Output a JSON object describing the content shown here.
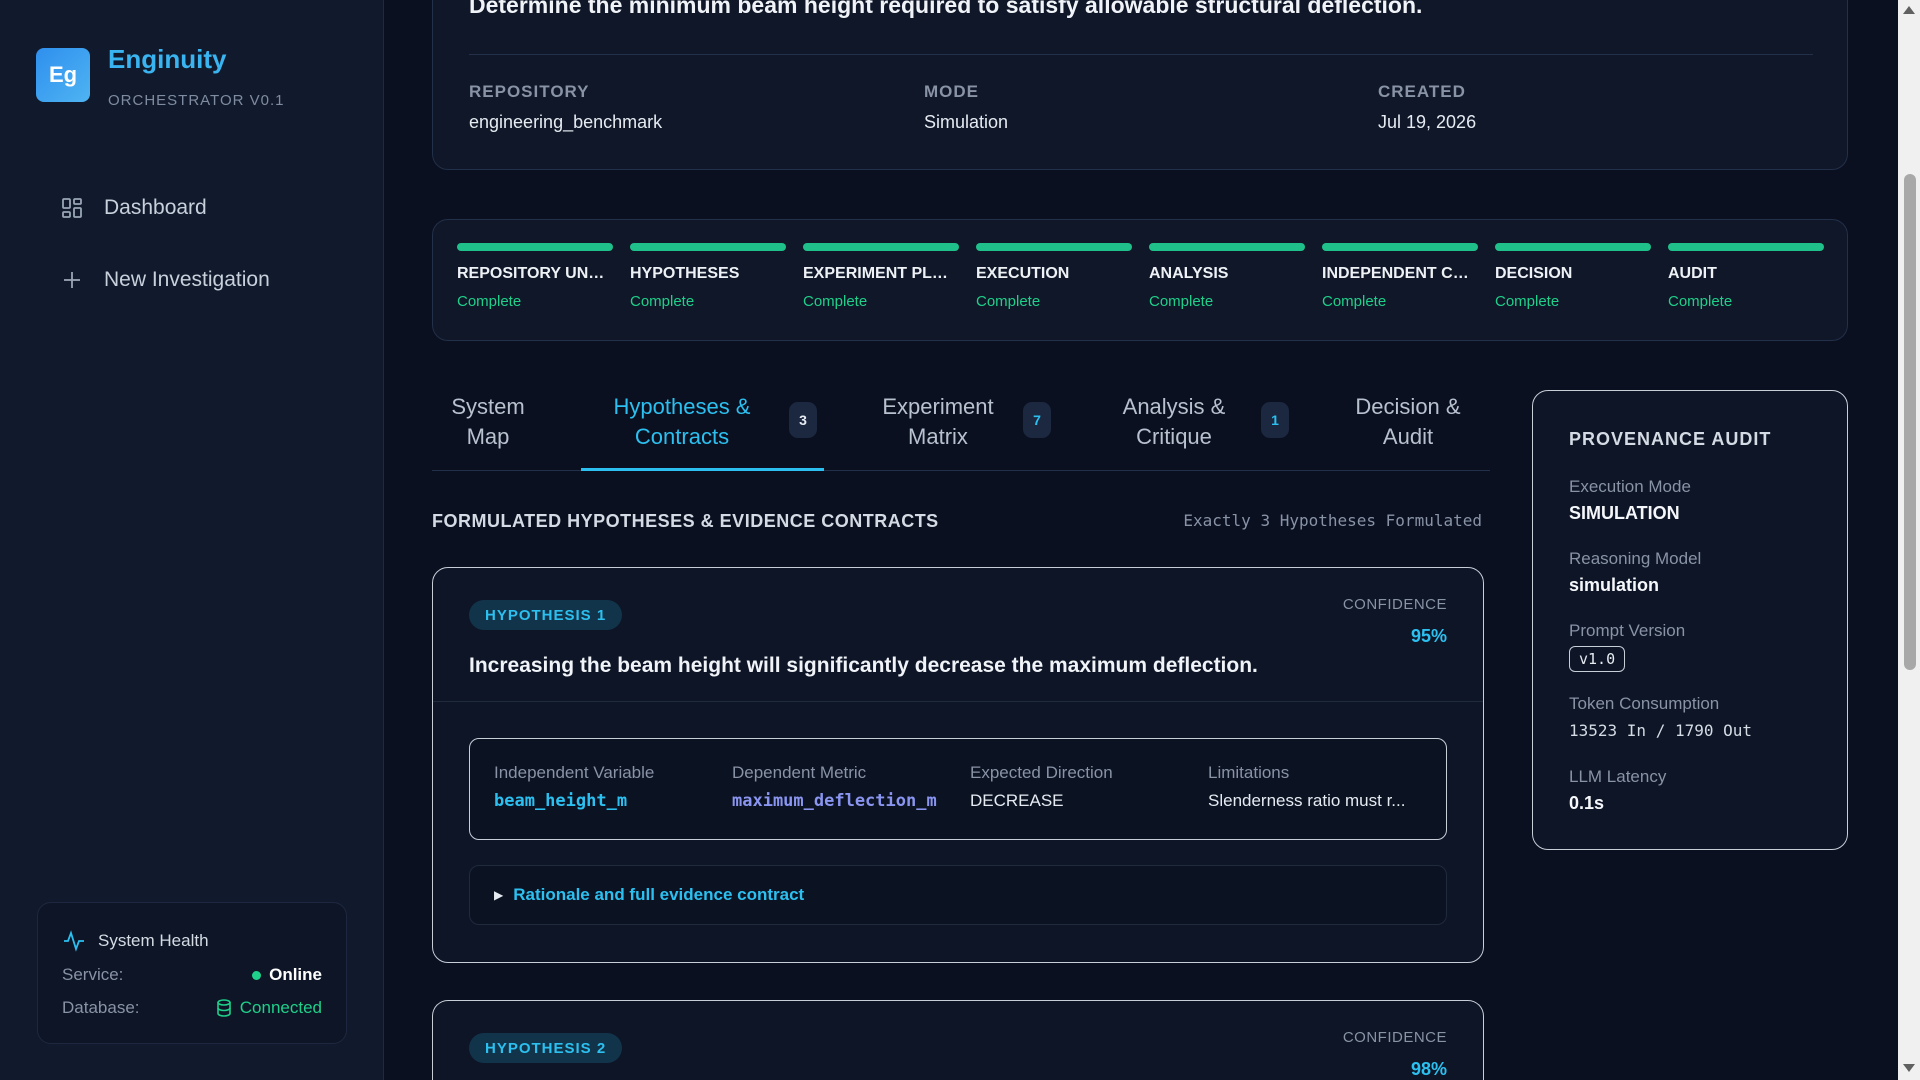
{
  "sidebar": {
    "logo": "Eg",
    "app_name": "Enginuity",
    "app_sub": "ORCHESTRATOR V0.1",
    "nav": [
      {
        "label": "Dashboard",
        "icon": "grid-icon"
      },
      {
        "label": "New Investigation",
        "icon": "plus-icon"
      }
    ],
    "health": {
      "title": "System Health",
      "service_label": "Service:",
      "service_value": "Online",
      "database_label": "Database:",
      "database_value": "Connected"
    }
  },
  "investigation": {
    "title": "Determine the minimum beam height required to satisfy allowable structural deflection.",
    "meta": [
      {
        "label": "REPOSITORY",
        "value": "engineering_benchmark"
      },
      {
        "label": "MODE",
        "value": "Simulation"
      },
      {
        "label": "CREATED",
        "value": "Jul 19, 2026"
      }
    ]
  },
  "pipeline": [
    {
      "name": "REPOSITORY UNDERSTANDING",
      "status": "Complete"
    },
    {
      "name": "HYPOTHESES",
      "status": "Complete"
    },
    {
      "name": "EXPERIMENT PLANNING",
      "status": "Complete"
    },
    {
      "name": "EXECUTION",
      "status": "Complete"
    },
    {
      "name": "ANALYSIS",
      "status": "Complete"
    },
    {
      "name": "INDEPENDENT CRITIQUE",
      "status": "Complete"
    },
    {
      "name": "DECISION",
      "status": "Complete"
    },
    {
      "name": "AUDIT",
      "status": "Complete"
    }
  ],
  "tabs": [
    {
      "line1": "System",
      "line2": "Map",
      "badge": ""
    },
    {
      "line1": "Hypotheses &",
      "line2": "Contracts",
      "badge": "3"
    },
    {
      "line1": "Experiment",
      "line2": "Matrix",
      "badge": "7"
    },
    {
      "line1": "Analysis &",
      "line2": "Critique",
      "badge": "1"
    },
    {
      "line1": "Decision &",
      "line2": "Audit",
      "badge": ""
    }
  ],
  "section": {
    "title": "FORMULATED HYPOTHESES & EVIDENCE CONTRACTS",
    "note": "Exactly 3 Hypotheses Formulated"
  },
  "hypotheses": [
    {
      "badge": "HYPOTHESIS 1",
      "confidence_label": "CONFIDENCE",
      "confidence": "95%",
      "statement": "Increasing the beam height will significantly decrease the maximum deflection.",
      "contract": {
        "independent_label": "Independent Variable",
        "independent": "beam_height_m",
        "dependent_label": "Dependent Metric",
        "dependent": "maximum_deflection_m",
        "direction_label": "Expected Direction",
        "direction": "DECREASE",
        "limitations_label": "Limitations",
        "limitations": "Slenderness ratio must r..."
      },
      "details_label": "Rationale and full evidence contract"
    },
    {
      "badge": "HYPOTHESIS 2",
      "confidence_label": "CONFIDENCE",
      "confidence": "98%"
    }
  ],
  "provenance": {
    "title": "PROVENANCE AUDIT",
    "execution_mode_label": "Execution Mode",
    "execution_mode": "SIMULATION",
    "reasoning_model_label": "Reasoning Model",
    "reasoning_model": "simulation",
    "prompt_version_label": "Prompt Version",
    "prompt_version": "v1.0",
    "token_label": "Token Consumption",
    "tokens": "13523 In / 1790 Out",
    "latency_label": "LLM Latency",
    "latency": "0.1s"
  },
  "colors": {
    "accent": "#2cc0f0",
    "success": "#1fd08a",
    "background": "#0a1020"
  }
}
